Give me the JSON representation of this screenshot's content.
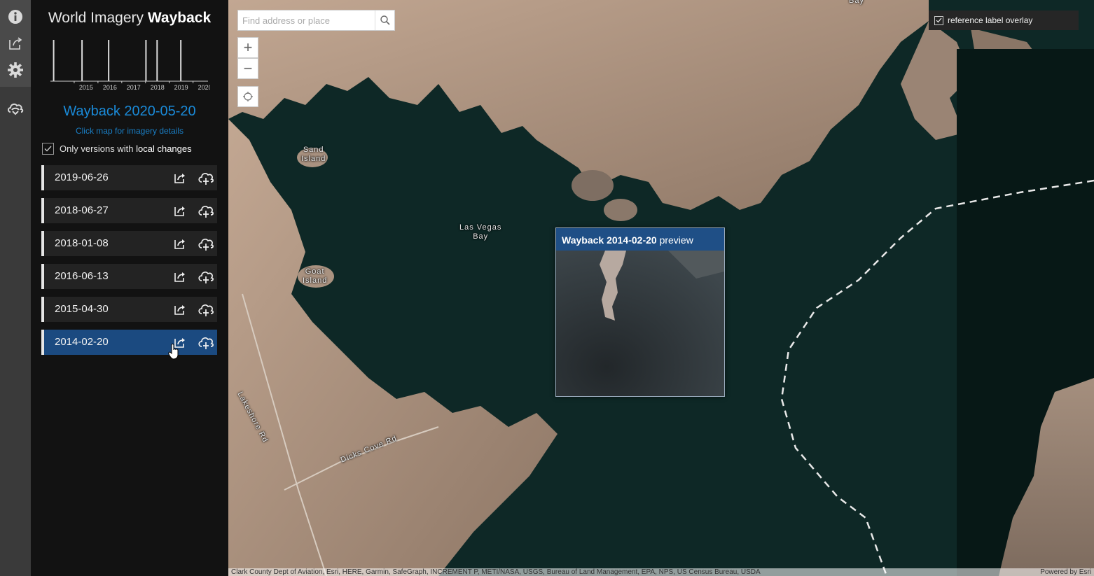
{
  "app": {
    "title_prefix": "World Imagery",
    "title_bold": "Wayback"
  },
  "rail": {
    "icons": [
      "info-icon",
      "share-icon",
      "gear-icon",
      "wayback-cloud-icon"
    ]
  },
  "chart": {
    "years": [
      "2015",
      "2016",
      "2017",
      "2018",
      "2019",
      "2020"
    ]
  },
  "chart_data": {
    "type": "bar",
    "title": "",
    "xlabel": "",
    "ylabel": "",
    "x_ticks": [
      "2015",
      "2016",
      "2017",
      "2018",
      "2019",
      "2020"
    ],
    "release_dates": [
      "2014-02-20",
      "2015-04-30",
      "2016-06-13",
      "2018-01-08",
      "2018-06-27",
      "2019-06-26"
    ],
    "values": [
      1,
      1,
      1,
      1,
      1,
      1
    ]
  },
  "current": {
    "version": "Wayback 2020-05-20",
    "hint": "Click map for imagery details"
  },
  "filter": {
    "label_prefix": "Only versions with",
    "label_bold": "local changes",
    "checked": true
  },
  "releases": [
    {
      "date": "2019-06-26",
      "active": false
    },
    {
      "date": "2018-06-27",
      "active": false
    },
    {
      "date": "2018-01-08",
      "active": false
    },
    {
      "date": "2016-06-13",
      "active": false
    },
    {
      "date": "2015-04-30",
      "active": false
    },
    {
      "date": "2014-02-20",
      "active": true
    }
  ],
  "map": {
    "search_placeholder": "Find address or place",
    "zoom_in": "+",
    "zoom_out": "−",
    "overlay_label": "reference label overlay",
    "labels": {
      "sand_island": "Sand\nIsland",
      "las_vegas_bay": "Las Vegas\nBay",
      "goat_island": "Goat\nIsland",
      "lakeshore_rd": "Lakeshore Rd",
      "dicks_cove_rd": "Dicks Cove Rd",
      "bay_top": "Bay"
    },
    "preview": {
      "title_bold": "Wayback 2014-02-20",
      "title_rest": " preview"
    },
    "attribution": "Clark County Dept of Aviation, Esri, HERE, Garmin, SafeGraph, INCREMENT P, METI/NASA, USGS, Bureau of Land Management, EPA, NPS, US Census Bureau, USDA",
    "powered": "Powered by Esri"
  },
  "colors": {
    "accent": "#1a8ad8",
    "active_row": "#1b4a80",
    "water": "#0f2a27",
    "land": "#b59a86"
  }
}
